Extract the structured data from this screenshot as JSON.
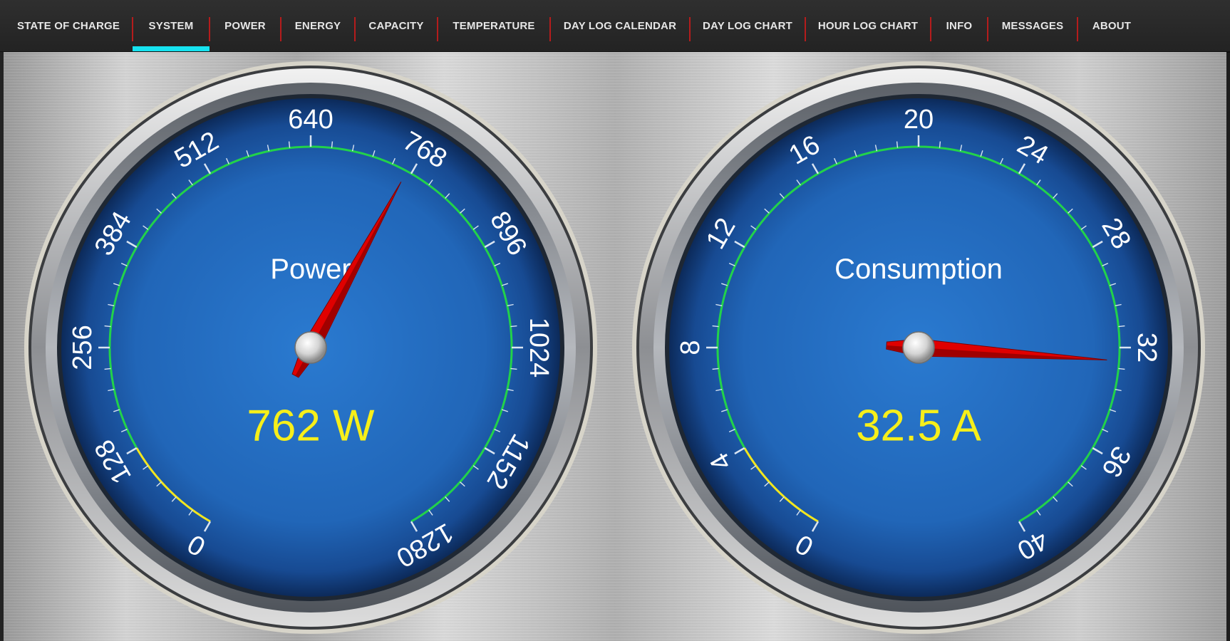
{
  "tabs": [
    {
      "label": "STATE OF CHARGE",
      "selected": false
    },
    {
      "label": "SYSTEM",
      "selected": true
    },
    {
      "label": "POWER",
      "selected": false
    },
    {
      "label": "ENERGY",
      "selected": false
    },
    {
      "label": "CAPACITY",
      "selected": false
    },
    {
      "label": "TEMPERATURE",
      "selected": false
    },
    {
      "label": "DAY LOG CALENDAR",
      "selected": false
    },
    {
      "label": "DAY LOG CHART",
      "selected": false
    },
    {
      "label": "HOUR LOG CHART",
      "selected": false
    },
    {
      "label": "INFO",
      "selected": false
    },
    {
      "label": "MESSAGES",
      "selected": false
    },
    {
      "label": "ABOUT",
      "selected": false
    }
  ],
  "colors": {
    "tab_indicator": "#16e2ef",
    "tab_separator": "#b51c1c",
    "scale_ring": "#22d24a",
    "scale_low": "#f2e61e",
    "value_text": "#f6ef1a",
    "needle": "#e00000"
  },
  "gauges": [
    {
      "title": "Power",
      "reading": "762 W",
      "value": 762,
      "min": 0,
      "max": 1280,
      "low_zone_end": 128,
      "major_ticks": [
        "0",
        "128",
        "256",
        "384",
        "512",
        "640",
        "768",
        "896",
        "1024",
        "1152",
        "1280"
      ]
    },
    {
      "title": "Consumption",
      "reading": "32.5 A",
      "value": 32.5,
      "min": 0,
      "max": 40,
      "low_zone_end": 4,
      "major_ticks": [
        "0",
        "4",
        "8",
        "12",
        "16",
        "20",
        "24",
        "28",
        "32",
        "36",
        "40"
      ]
    }
  ]
}
